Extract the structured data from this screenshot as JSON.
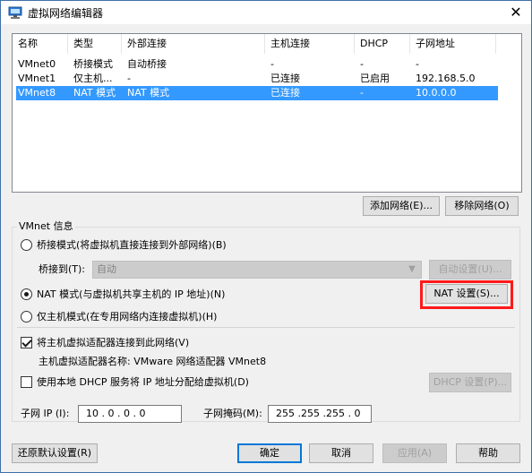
{
  "window": {
    "title": "虚拟网络编辑器",
    "close_symbol": "✕"
  },
  "list": {
    "columns": [
      "名称",
      "类型",
      "外部连接",
      "主机连接",
      "DHCP",
      "子网地址"
    ],
    "rows": [
      {
        "name": "VMnet0",
        "type": "桥接模式",
        "external": "自动桥接",
        "host": "-",
        "dhcp": "-",
        "subnet": "-"
      },
      {
        "name": "VMnet1",
        "type": "仅主机...",
        "external": "-",
        "host": "已连接",
        "dhcp": "已启用",
        "subnet": "192.168.5.0"
      },
      {
        "name": "VMnet8",
        "type": "NAT 模式",
        "external": "NAT 模式",
        "host": "已连接",
        "dhcp": "-",
        "subnet": "10.0.0.0",
        "selected": true
      }
    ]
  },
  "buttons": {
    "add_network": "添加网络(E)...",
    "remove_network": "移除网络(O)",
    "auto_settings": "自动设置(U)...",
    "nat_settings": "NAT 设置(S)...",
    "dhcp_settings": "DHCP 设置(P)...",
    "restore_defaults": "还原默认设置(R)",
    "ok": "确定",
    "cancel": "取消",
    "apply": "应用(A)",
    "help": "帮助"
  },
  "vmnet_info": {
    "legend": "VMnet 信息",
    "bridged_label": "桥接模式(将虚拟机直接连接到外部网络)(B)",
    "bridged_to_label": "桥接到(T):",
    "bridged_to_value": "自动",
    "nat_label": "NAT 模式(与虚拟机共享主机的 IP 地址)(N)",
    "hostonly_label": "仅主机模式(在专用网络内连接虚拟机)(H)",
    "selected_mode": "nat",
    "connect_adapter_label": "将主机虚拟适配器连接到此网络(V)",
    "connect_adapter_checked": true,
    "adapter_name_label": "主机虚拟适配器名称: VMware 网络适配器 VMnet8",
    "use_dhcp_label": "使用本地 DHCP 服务将 IP 地址分配给虚拟机(D)",
    "use_dhcp_checked": false,
    "subnet_ip_label": "子网 IP (I):",
    "subnet_ip_value": "10 . 0 . 0 . 0",
    "subnet_mask_label": "子网掩码(M):",
    "subnet_mask_value": "255 .255 .255 . 0"
  },
  "colors": {
    "selection": "#3399ff",
    "highlight_box": "#ff1a1a",
    "default_button_border": "#0078d7"
  }
}
